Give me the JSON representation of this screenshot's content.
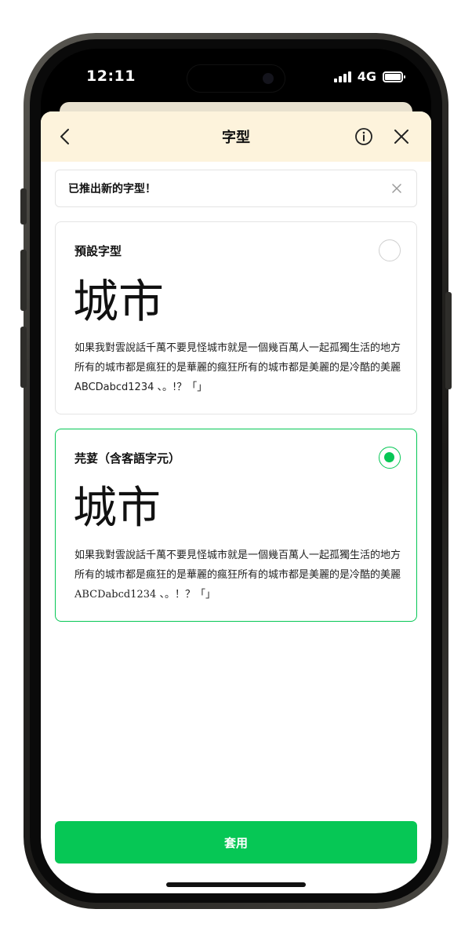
{
  "status_bar": {
    "time": "12:11",
    "network": "4G",
    "signal_bars": 4,
    "battery_level": 1.0
  },
  "header": {
    "title": "字型"
  },
  "notice": {
    "text": "已推出新的字型！"
  },
  "font_options": [
    {
      "name": "預設字型",
      "selected": false,
      "preview_large": "城市",
      "preview_text": "如果我對雲說話千萬不要見怪城市就是一個幾百萬人一起孤獨生活的地方所有的城市都是瘋狂的是華麗的瘋狂所有的城市都是美麗的是冷酷的美麗 ABCDabcd1234 、。!？「」"
    },
    {
      "name": "芫荽（含客語字元）",
      "selected": true,
      "preview_large": "城市",
      "preview_text": "如果我對雲說話千萬不要見怪城市就是一個幾百萬人一起孤獨生活的地方所有的城市都是瘋狂的是華麗的瘋狂所有的城市都是美麗的是冷酷的美麗ABCDabcd1234 、。！？「」"
    }
  ],
  "actions": {
    "apply_label": "套用"
  },
  "colors": {
    "accent": "#06c755",
    "header_bg": "#fdf3dc"
  }
}
